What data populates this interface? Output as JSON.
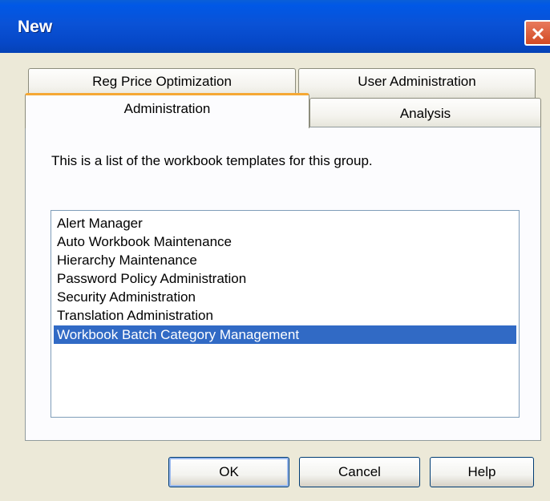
{
  "window": {
    "title": "New"
  },
  "tabs": [
    {
      "label": "Reg Price Optimization",
      "active": false
    },
    {
      "label": "User Administration",
      "active": false
    },
    {
      "label": "Administration",
      "active": true
    },
    {
      "label": "Analysis",
      "active": false
    }
  ],
  "panel": {
    "description": "This is a list of the workbook templates for this group."
  },
  "templates": [
    "Alert Manager",
    "Auto Workbook Maintenance",
    "Hierarchy Maintenance",
    "Password Policy Administration",
    "Security Administration",
    "Translation Administration",
    "Workbook Batch Category Management"
  ],
  "selected_template": "Workbook Batch Category Management",
  "buttons": {
    "ok": "OK",
    "cancel": "Cancel",
    "help": "Help"
  },
  "colors": {
    "selection": "#316ac5",
    "active_tab_accent": "#f5a834",
    "titlebar": "#0a52d6",
    "close": "#d24a24"
  }
}
